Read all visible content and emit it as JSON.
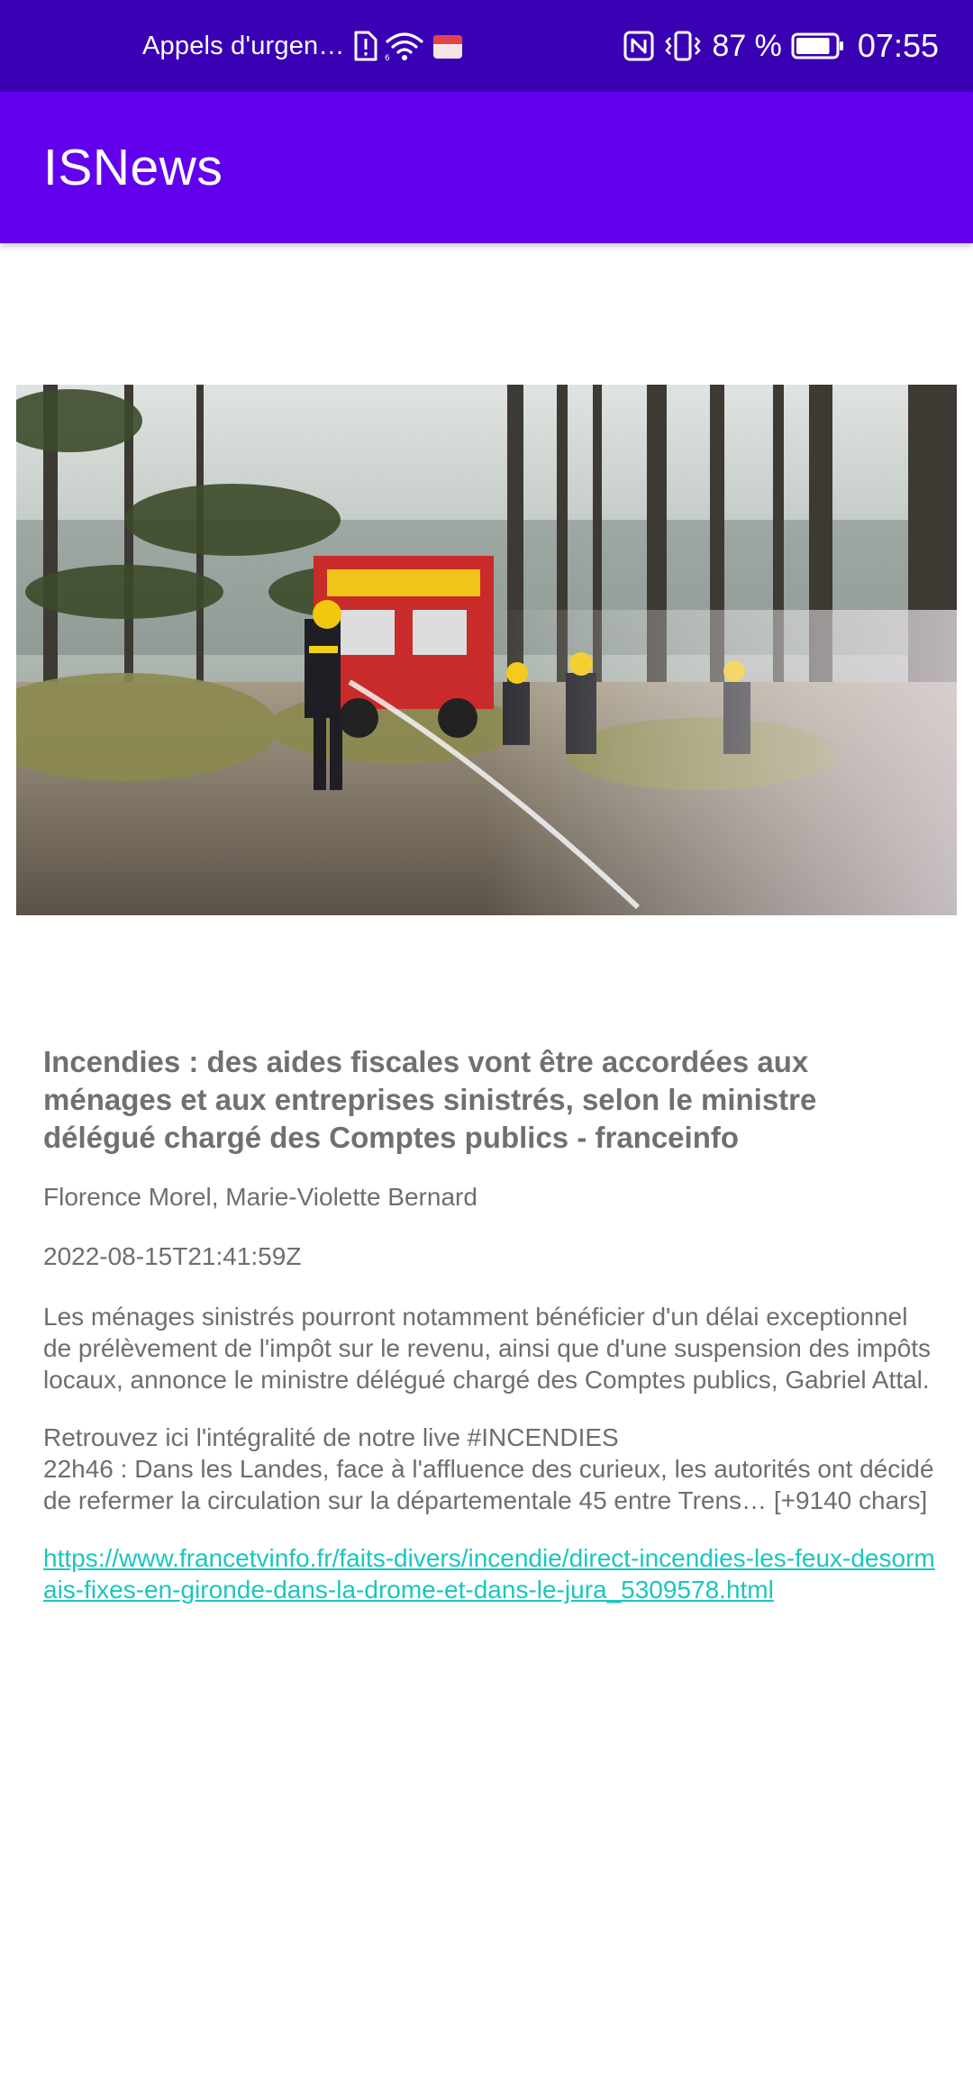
{
  "status_bar": {
    "carrier": "Appels d'urgen…",
    "battery_percent": "87 %",
    "time": "07:55",
    "icons": [
      "sim-alert-icon",
      "wifi-icon",
      "notification-app-icon",
      "nfc-icon",
      "vibrate-icon",
      "battery-icon"
    ],
    "battery_level": 0.87
  },
  "app_bar": {
    "title": "ISNews",
    "color": "#6200ee"
  },
  "article": {
    "image": "firefighters-forest-fire-photo",
    "title": "Incendies : des aides fiscales vont être accordées aux ménages et aux entreprises sinistrés, selon le ministre délégué chargé des Comptes publics - franceinfo",
    "author": "Florence Morel, Marie-Violette Bernard",
    "published_at": "2022-08-15T21:41:59Z",
    "description": "Les ménages sinistrés pourront notamment bénéficier d'un délai exceptionnel de prélèvement de l'impôt sur le revenu, ainsi que d'une suspension des impôts locaux, annonce le ministre délégué chargé des Comptes publics, Gabriel Attal.",
    "content": "Retrouvez ici l'intégralité de notre live #INCENDIES\n22h46 : Dans les Landes, face à l'affluence des curieux, les autorités ont décidé de refermer la circulation sur la départementale 45 entre Trens… [+9140 chars]",
    "url": "https://www.francetvinfo.fr/faits-divers/incendie/direct-incendies-les-feux-desormais-fixes-en-gironde-dans-la-drome-et-dans-le-jura_5309578.html",
    "link_color": "#1ac6c0"
  }
}
